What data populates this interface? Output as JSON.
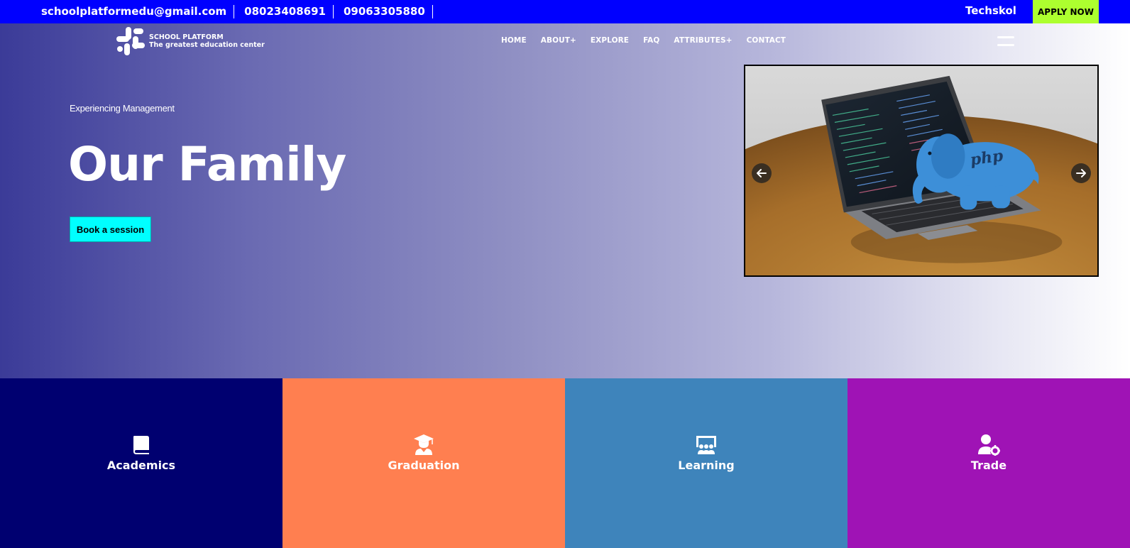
{
  "topbar": {
    "email": "schoolplatformedu@gmail.com",
    "phone1": "08023408691",
    "phone2": "09063305880",
    "brand": "Techskol",
    "apply_label": "APPLY NOW",
    "bg_color": "#0000ff",
    "apply_color": "#adff2f"
  },
  "header": {
    "logo_title": "SCHOOL PLATFORM",
    "logo_tagline": "The greatest education center",
    "nav": [
      "HOME",
      "ABOUT+",
      "EXPLORE",
      "FAQ",
      "ATTRIBUTES+",
      "CONTACT"
    ],
    "menu_icon": "hamburger-icon"
  },
  "hero": {
    "eyebrow": "Experiencing Management",
    "headline": "Our Family",
    "cta_label": "Book a session",
    "cta_color": "#00ffff",
    "carousel": {
      "image": "laptop-with-php-elephant",
      "prev_icon": "arrow-left-icon",
      "next_icon": "arrow-right-icon"
    }
  },
  "tiles": [
    {
      "label": "Academics",
      "icon": "book-icon",
      "color": "#000070"
    },
    {
      "label": "Graduation",
      "icon": "graduate-icon",
      "color": "#ff7f50"
    },
    {
      "label": "Learning",
      "icon": "classroom-icon",
      "color": "#3e84bb"
    },
    {
      "label": "Trade",
      "icon": "user-gear-icon",
      "color": "#9f13b5"
    }
  ]
}
